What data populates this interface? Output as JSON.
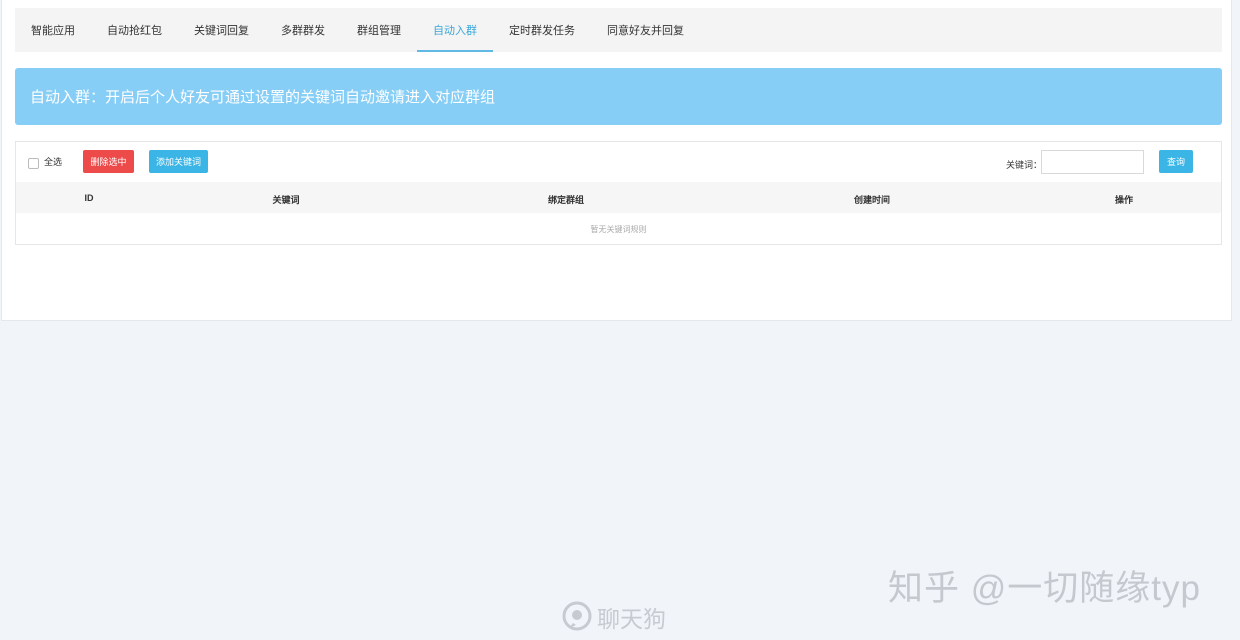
{
  "tabs": [
    {
      "label": "智能应用"
    },
    {
      "label": "自动抢红包"
    },
    {
      "label": "关键词回复"
    },
    {
      "label": "多群群发"
    },
    {
      "label": "群组管理"
    },
    {
      "label": "自动入群",
      "active": true
    },
    {
      "label": "定时群发任务"
    },
    {
      "label": "同意好友并回复"
    }
  ],
  "banner": {
    "text": "自动入群：开启后个人好友可通过设置的关键词自动邀请进入对应群组"
  },
  "toolbar": {
    "select_all_label": "全选",
    "delete_selected_label": "删除选中",
    "add_keyword_label": "添加关键词",
    "keyword_label": "关键词：",
    "keyword_value": "",
    "search_label": "查询"
  },
  "table": {
    "headers": [
      "ID",
      "关键词",
      "绑定群组",
      "创建时间",
      "操作"
    ],
    "rows": [],
    "empty_text": "暂无关键词规则"
  },
  "watermarks": {
    "zhihu": "知乎 @一切随缘typ",
    "liaotiangou": "聊天狗"
  },
  "colors": {
    "accent": "#3aa6d8",
    "banner": "#87cef7",
    "danger": "#ed4a4a",
    "primary_button": "#3ab5e6"
  }
}
